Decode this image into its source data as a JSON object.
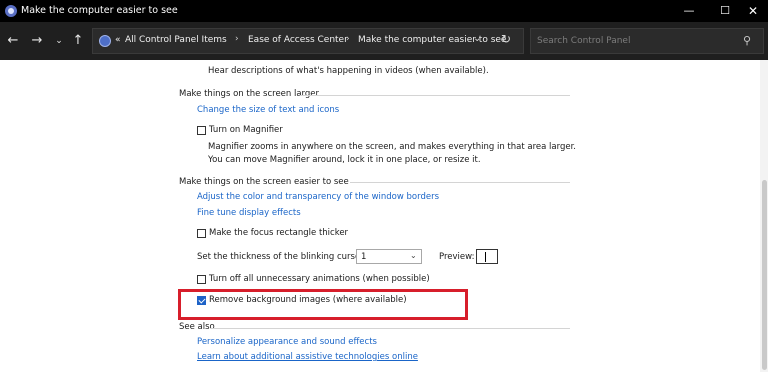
{
  "window": {
    "title": "Make the computer easier to see",
    "minimize_glyph": "—",
    "maximize_glyph": "☐",
    "close_glyph": "✕"
  },
  "nav": {
    "back_glyph": "←",
    "forward_glyph": "→",
    "recent_glyph": "⌄",
    "up_glyph": "↑"
  },
  "address": {
    "overflow": "«",
    "crumbs": [
      "All Control Panel Items",
      "Ease of Access Center",
      "Make the computer easier to see"
    ],
    "separator": "›",
    "dropdown_glyph": "⌄",
    "refresh_glyph": "↻"
  },
  "search": {
    "placeholder": "Search Control Panel",
    "icon_glyph": "⚲"
  },
  "content": {
    "top_text": "Hear descriptions of what's happening in videos (when available).",
    "larger": {
      "heading": "Make things on the screen larger",
      "link_text_size": "Change the size of text and icons",
      "magnifier_label": "Turn on Magnifier",
      "magnifier_checked": false,
      "magnifier_desc": "Magnifier zooms in anywhere on the screen, and makes everything in that area larger. You can move Magnifier around, lock it in one place, or resize it."
    },
    "easier": {
      "heading": "Make things on the screen easier to see",
      "link_color": "Adjust the color and transparency of the window borders",
      "link_display": "Fine tune display effects",
      "focus_label": "Make the focus rectangle thicker",
      "focus_checked": false,
      "cursor_label": "Set the thickness of the blinking cursor:",
      "cursor_value": "1",
      "cursor_dropdown_glyph": "⌄",
      "preview_label": "Preview:",
      "animations_label": "Turn off all unnecessary animations (when possible)",
      "animations_checked": false,
      "background_label": "Remove background images (where available)",
      "background_checked": true
    },
    "see_also": {
      "heading": "See also",
      "links": [
        "Personalize appearance and sound effects",
        "Learn about additional assistive technologies online"
      ]
    }
  },
  "colors": {
    "link": "#1a65c8",
    "highlight_border": "#d71e2b",
    "checkbox_checked": "#1d62c7"
  }
}
